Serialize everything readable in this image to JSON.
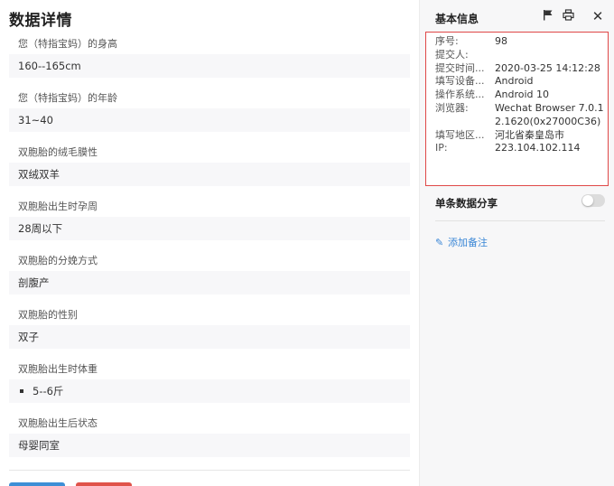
{
  "main": {
    "title": "数据详情",
    "fields": [
      {
        "label": "您（特指宝妈）的身高",
        "value": "160--165cm"
      },
      {
        "label": "您（特指宝妈）的年龄",
        "value": "31~40"
      },
      {
        "label": "双胞胎的绒毛膜性",
        "value": "双绒双羊"
      },
      {
        "label": "双胞胎出生时孕周",
        "value": "28周以下"
      },
      {
        "label": "双胞胎的分娩方式",
        "value": "剖腹产"
      },
      {
        "label": "双胞胎的性别",
        "value": "双子"
      },
      {
        "label": "双胞胎出生时体重",
        "value": "5--6斤"
      },
      {
        "label": "双胞胎出生后状态",
        "value": "母婴同室"
      }
    ]
  },
  "panel": {
    "title": "基本信息",
    "info": [
      {
        "key": "序号:",
        "value": "98"
      },
      {
        "key": "提交人:",
        "value": ""
      },
      {
        "key": "提交时间...",
        "value": "2020-03-25 14:12:28"
      },
      {
        "key": "填写设备...",
        "value": "Android"
      },
      {
        "key": "操作系统...",
        "value": "Android 10"
      },
      {
        "key": "浏览器:",
        "value": "Wechat Browser 7.0.12.1620(0x27000C36)"
      },
      {
        "key": "填写地区...",
        "value": "河北省秦皇岛市"
      },
      {
        "key": "IP:",
        "value": "223.104.102.114"
      }
    ],
    "share_label": "单条数据分享",
    "share_enabled": false,
    "add_note": "添加备注"
  },
  "colors": {
    "highlight_border": "#e04848",
    "link": "#3b87d6",
    "primary_button": "#3d8fd6",
    "danger_button": "#e0534a"
  }
}
